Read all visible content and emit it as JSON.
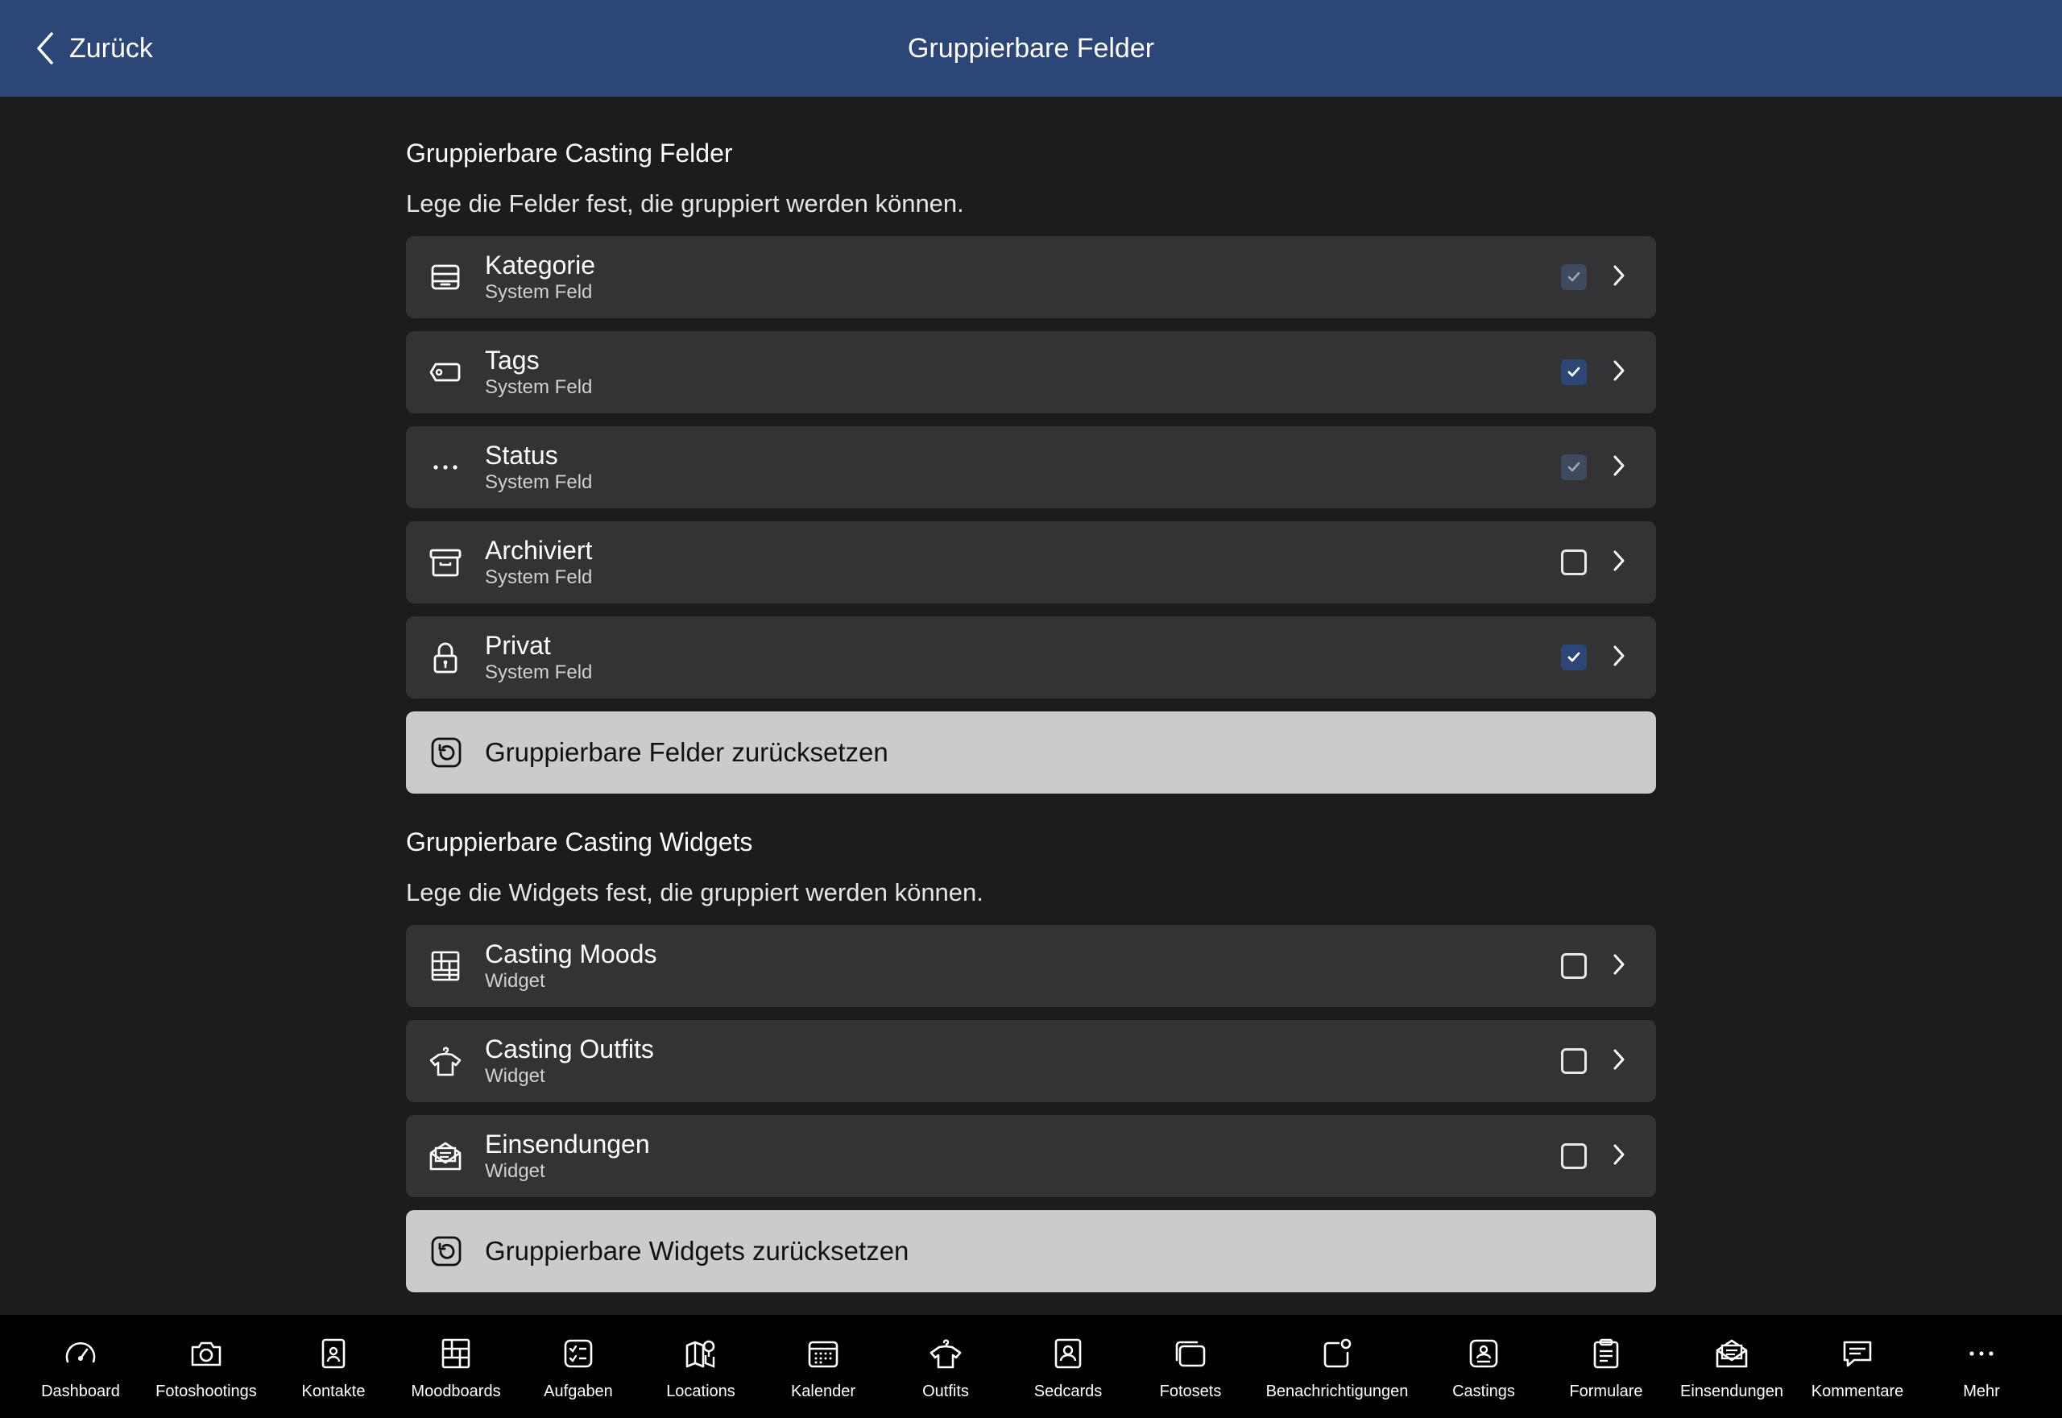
{
  "header": {
    "back_label": "Zurück",
    "title": "Gruppierbare Felder"
  },
  "fields_section": {
    "title": "Gruppierbare Casting Felder",
    "description": "Lege die Felder fest, die gruppiert werden können.",
    "items": [
      {
        "name": "Kategorie",
        "subtitle": "System Feld",
        "icon": "tray-icon",
        "checked": true,
        "disabled": true
      },
      {
        "name": "Tags",
        "subtitle": "System Feld",
        "icon": "tag-icon",
        "checked": true,
        "disabled": false
      },
      {
        "name": "Status",
        "subtitle": "System Feld",
        "icon": "ellipsis-icon",
        "checked": true,
        "disabled": true
      },
      {
        "name": "Archiviert",
        "subtitle": "System Feld",
        "icon": "archive-box-icon",
        "checked": false,
        "disabled": false
      },
      {
        "name": "Privat",
        "subtitle": "System Feld",
        "icon": "lock-icon",
        "checked": true,
        "disabled": false
      }
    ],
    "reset_label": "Gruppierbare Felder zurücksetzen"
  },
  "widgets_section": {
    "title": "Gruppierbare Casting Widgets",
    "description": "Lege die Widgets fest, die gruppiert werden können.",
    "items": [
      {
        "name": "Casting Moods",
        "subtitle": "Widget",
        "icon": "moodboard-grid-icon",
        "checked": false
      },
      {
        "name": "Casting Outfits",
        "subtitle": "Widget",
        "icon": "shirt-hanger-icon",
        "checked": false
      },
      {
        "name": "Einsendungen",
        "subtitle": "Widget",
        "icon": "envelope-open-icon",
        "checked": false
      }
    ],
    "reset_label": "Gruppierbare Widgets zurücksetzen"
  },
  "tabbar": [
    {
      "label": "Dashboard",
      "icon": "speedometer-icon"
    },
    {
      "label": "Fotoshootings",
      "icon": "camera-icon"
    },
    {
      "label": "Kontakte",
      "icon": "contact-card-icon"
    },
    {
      "label": "Moodboards",
      "icon": "moodboard-grid-icon"
    },
    {
      "label": "Aufgaben",
      "icon": "checklist-icon"
    },
    {
      "label": "Locations",
      "icon": "map-pin-icon"
    },
    {
      "label": "Kalender",
      "icon": "calendar-icon"
    },
    {
      "label": "Outfits",
      "icon": "shirt-hanger-icon"
    },
    {
      "label": "Sedcards",
      "icon": "person-card-icon"
    },
    {
      "label": "Fotosets",
      "icon": "photo-stack-icon"
    },
    {
      "label": "Benachrichtigungen",
      "icon": "notification-icon"
    },
    {
      "label": "Castings",
      "icon": "casting-badge-icon"
    },
    {
      "label": "Formulare",
      "icon": "clipboard-form-icon"
    },
    {
      "label": "Einsendungen",
      "icon": "envelope-open-icon"
    },
    {
      "label": "Kommentare",
      "icon": "comment-bubble-icon"
    },
    {
      "label": "Mehr",
      "icon": "more-dots-icon"
    }
  ],
  "colors": {
    "header": "#2c4678",
    "background": "#1c1c1e",
    "row": "#333335",
    "reset_button": "#cbcbcb"
  }
}
